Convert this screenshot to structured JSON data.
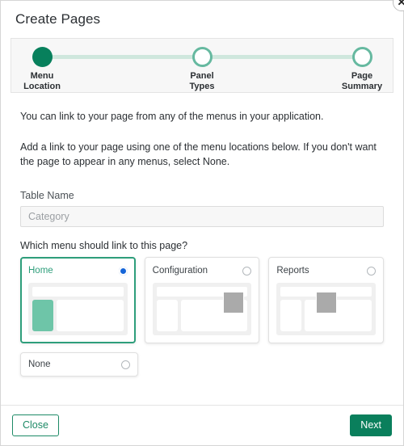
{
  "dialog": {
    "title": "Create Pages",
    "close_icon": "close-x-icon"
  },
  "stepper": {
    "steps": [
      {
        "label": "Menu\nLocation",
        "line1": "Menu",
        "line2": "Location",
        "state": "active"
      },
      {
        "label": "Panel Types",
        "line1": "Panel",
        "line2": "Types",
        "state": "todo"
      },
      {
        "label": "Page Summary",
        "line1": "Page",
        "line2": "Summary",
        "state": "todo"
      }
    ]
  },
  "body": {
    "paragraph_1": "You can link to your page from any of the menus in your application.",
    "paragraph_2": "Add a link to your page using one of the menu locations below. If you don't want the page to appear in any menus, select None.",
    "table_name_label": "Table Name",
    "table_name_value": "Category",
    "menu_question": "Which menu should link to this page?"
  },
  "options": [
    {
      "label": "Home",
      "selected": true,
      "radio_icon": "radio-selected-icon"
    },
    {
      "label": "Configuration",
      "selected": false,
      "radio_icon": "radio-unselected-icon"
    },
    {
      "label": "Reports",
      "selected": false,
      "radio_icon": "radio-unselected-icon"
    },
    {
      "label": "None",
      "selected": false,
      "radio_icon": "radio-unselected-icon"
    }
  ],
  "footer": {
    "close_label": "Close",
    "next_label": "Next"
  },
  "colors": {
    "accent_green": "#0a7f5c",
    "accent_green_light": "#6ec5a8",
    "step_line": "#cfe7dd",
    "radio_blue": "#1565d8",
    "preview_grey_block": "#aaaaaa"
  }
}
